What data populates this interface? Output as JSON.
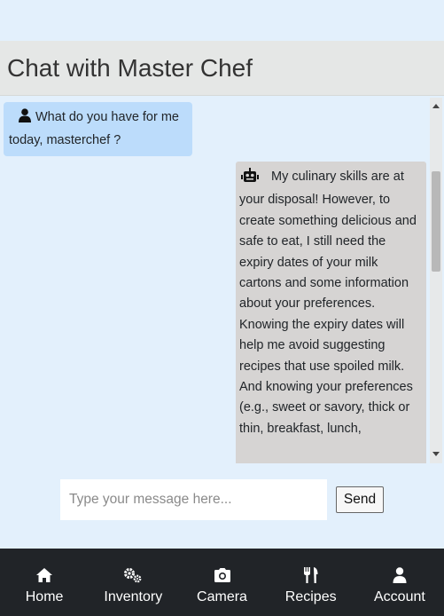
{
  "header": {
    "title": "Chat with Master Chef"
  },
  "messages": [
    {
      "sender": "user",
      "icon": "user-icon",
      "text": "What do you have for me today, masterchef ?"
    },
    {
      "sender": "bot",
      "icon": "robot-icon",
      "text": "My culinary skills are at your disposal! However, to create something delicious and safe to eat, I still need the expiry dates of your milk cartons and some information about your preferences. Knowing the expiry dates will help me avoid suggesting recipes that use spoiled milk. And knowing your preferences (e.g., sweet or savory, thick or thin, breakfast, lunch,"
    }
  ],
  "composer": {
    "placeholder": "Type your message here...",
    "send_label": "Send"
  },
  "nav": {
    "items": [
      {
        "label": "Home",
        "icon": "home-icon"
      },
      {
        "label": "Inventory",
        "icon": "cogs-icon"
      },
      {
        "label": "Camera",
        "icon": "camera-icon"
      },
      {
        "label": "Recipes",
        "icon": "utensils-icon"
      },
      {
        "label": "Account",
        "icon": "user-icon"
      }
    ]
  },
  "colors": {
    "background": "#e3f0fc",
    "header_bg": "#e5e7e6",
    "user_bubble": "#bcdcfb",
    "bot_bubble": "#d6d4d3",
    "nav_bg": "#212428"
  }
}
